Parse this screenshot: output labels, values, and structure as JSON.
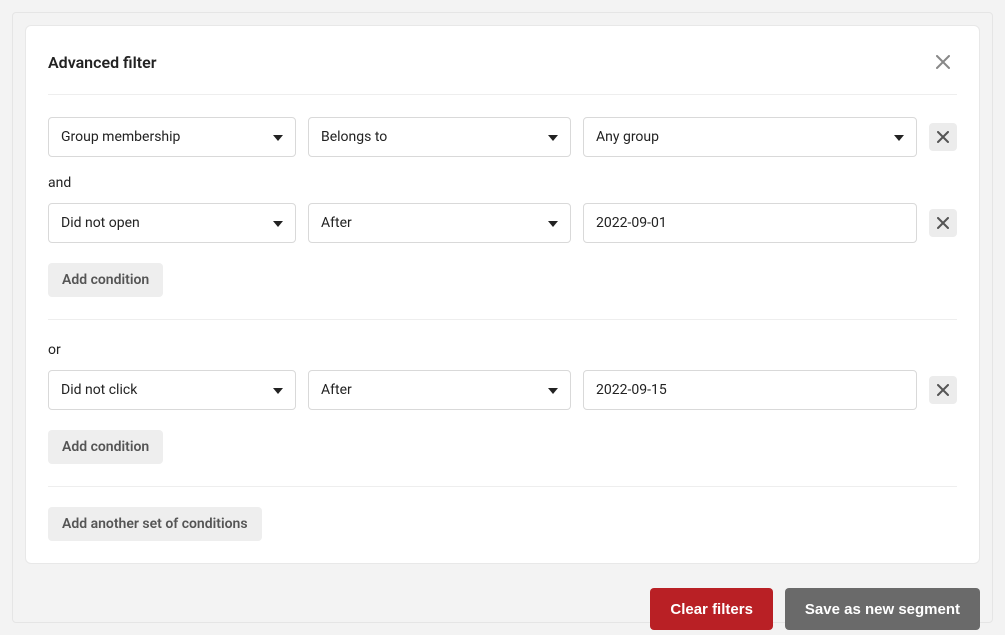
{
  "title": "Advanced filter",
  "groups": [
    {
      "conj_before": null,
      "rows": [
        {
          "conj_before": null,
          "field": "Group membership",
          "operator": "Belongs to",
          "value": "Any group",
          "value_is_select": true
        },
        {
          "conj_before": "and",
          "field": "Did not open",
          "operator": "After",
          "value": "2022-09-01",
          "value_is_select": false
        }
      ],
      "add_condition_label": "Add condition"
    },
    {
      "conj_before": "or",
      "rows": [
        {
          "conj_before": null,
          "field": "Did not click",
          "operator": "After",
          "value": "2022-09-15",
          "value_is_select": false
        }
      ],
      "add_condition_label": "Add condition"
    }
  ],
  "add_another_label": "Add another set of conditions",
  "footer": {
    "clear": "Clear filters",
    "save": "Save as new segment"
  }
}
